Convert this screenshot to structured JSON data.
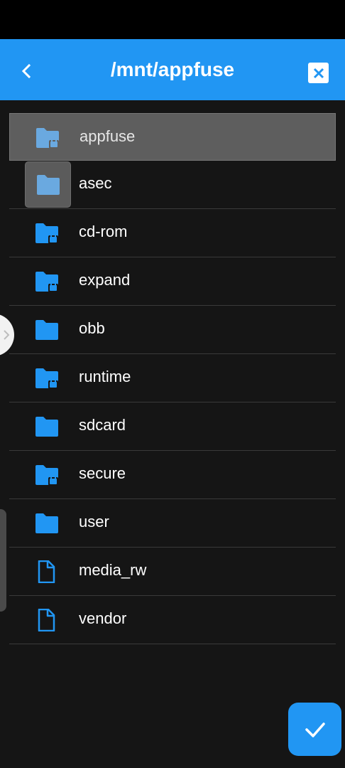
{
  "header": {
    "title": "/mnt/appfuse",
    "back_icon": "chevron-left-icon",
    "close_icon": "close-box-icon",
    "accent_color": "#2196f3"
  },
  "files": [
    {
      "name": "appfuse",
      "type": "folder-locked",
      "selected": true
    },
    {
      "name": "asec",
      "type": "folder"
    },
    {
      "name": "cd-rom",
      "type": "folder-locked"
    },
    {
      "name": "expand",
      "type": "folder-locked"
    },
    {
      "name": "obb",
      "type": "folder"
    },
    {
      "name": "runtime",
      "type": "folder-locked"
    },
    {
      "name": "sdcard",
      "type": "folder"
    },
    {
      "name": "secure",
      "type": "folder-locked"
    },
    {
      "name": "user",
      "type": "folder"
    },
    {
      "name": "media_rw",
      "type": "file"
    },
    {
      "name": "vendor",
      "type": "file"
    }
  ],
  "fab": {
    "icon": "checkmark-icon"
  }
}
